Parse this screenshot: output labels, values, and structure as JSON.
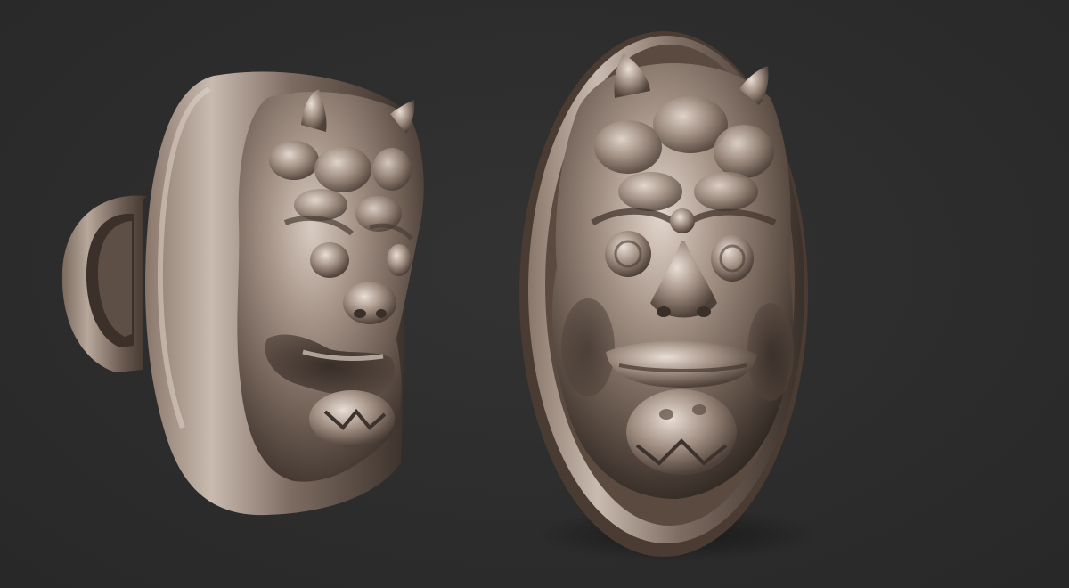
{
  "scene": {
    "background_color": "#2d2d2d",
    "material_color": "#8f7d72",
    "objects": [
      {
        "name": "demon-mask-ring",
        "view": "three-quarter"
      },
      {
        "name": "demon-mask-pendant",
        "view": "front"
      }
    ]
  }
}
